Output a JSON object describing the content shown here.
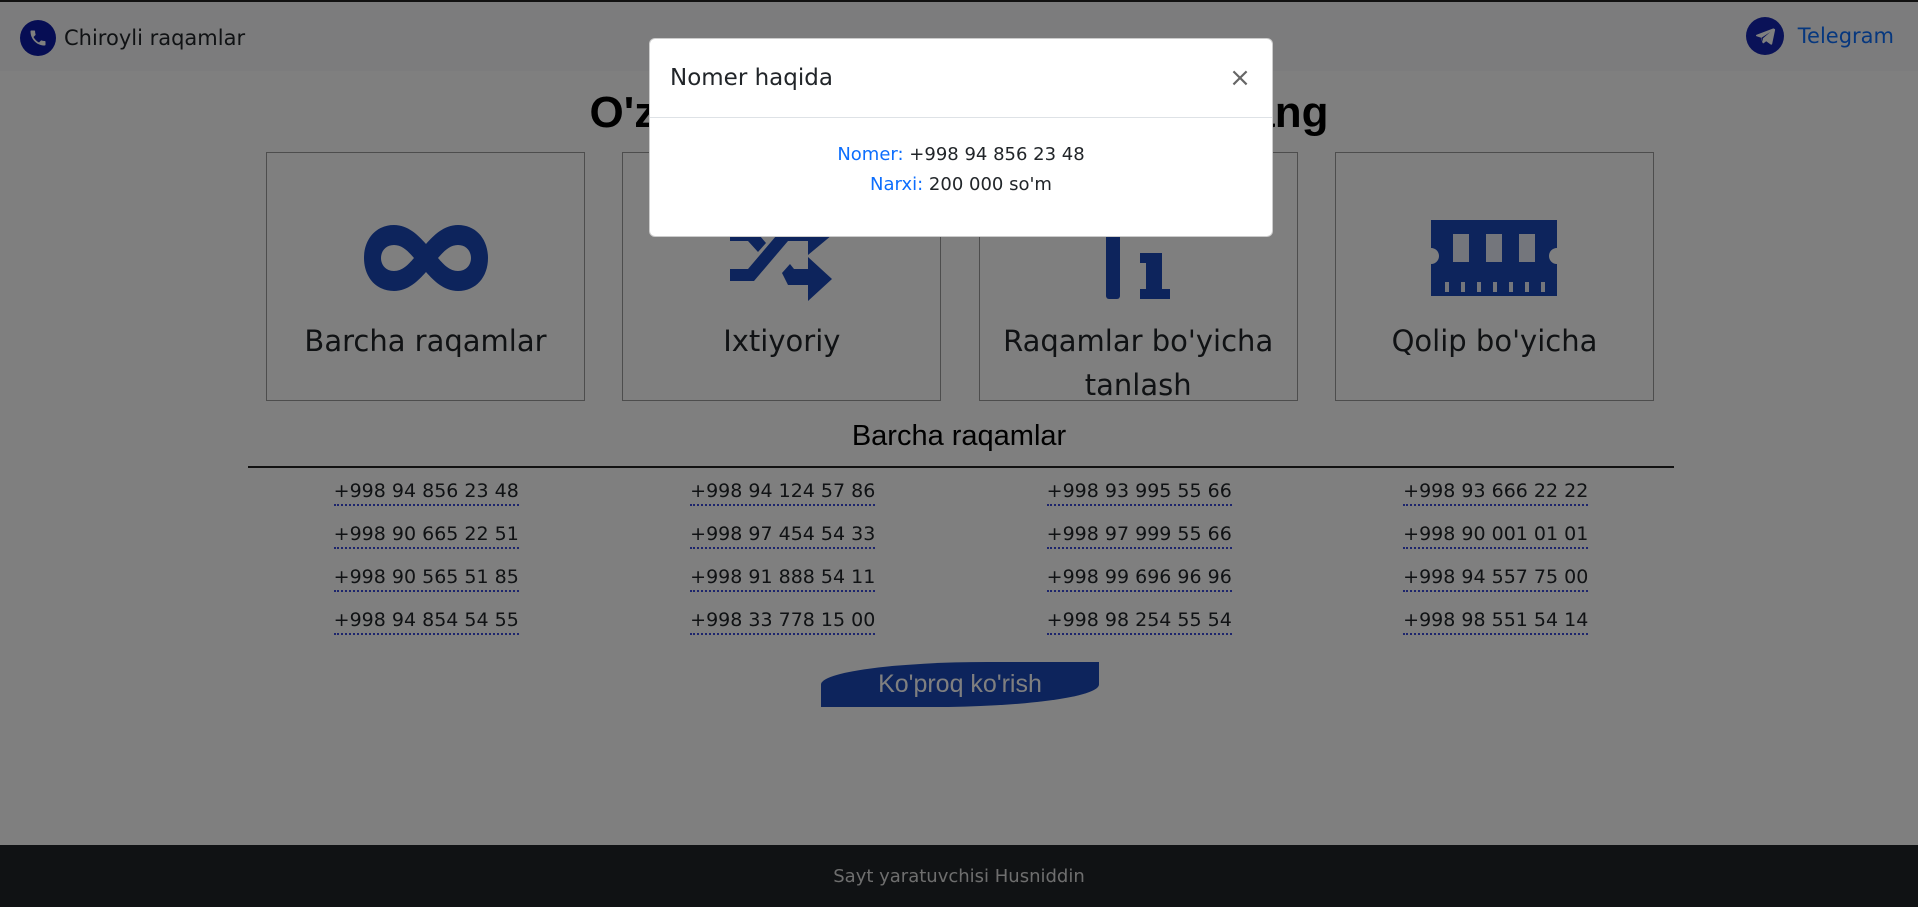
{
  "navbar": {
    "brand": "Chiroyli raqamlar",
    "telegram": "Telegram"
  },
  "hero": {
    "heading": "O'zingizga yoqqan raqamni tanlang"
  },
  "categories": [
    {
      "label": "Barcha raqamlar",
      "icon": "infinity-icon"
    },
    {
      "label": "Ixtiyoriy",
      "icon": "shuffle-icon"
    },
    {
      "label": "Raqamlar bo'yicha tanlash",
      "icon": "numbers-info-icon"
    },
    {
      "label": "Qolip bo'yicha",
      "icon": "memory-icon"
    }
  ],
  "list": {
    "title": "Barcha raqamlar",
    "numbers": [
      "+998 94 856 23 48",
      "+998 94 124 57 86",
      "+998 93 995 55 66",
      "+998 93 666 22 22",
      "+998 90 665 22 51",
      "+998 97 454 54 33",
      "+998 97 999 55 66",
      "+998 90 001 01 01",
      "+998 90 565 51 85",
      "+998 91 888 54 11",
      "+998 99 696 96 96",
      "+998 94 557 75 00",
      "+998 94 854 54 55",
      "+998 33 778 15 00",
      "+998 98 254 55 54",
      "+998 98 551 54 14"
    ],
    "more_button": "Ko'proq ko'rish"
  },
  "footer": {
    "text": "Sayt yaratuvchisi Husniddin"
  },
  "modal": {
    "title": "Nomer haqida",
    "close": "×",
    "number_label": "Nomer:",
    "number_value": "+998 94 856 23 48",
    "price_label": "Narxi:",
    "price_value": "200 000 so'm"
  },
  "colors": {
    "accent": "#1a49b8",
    "link": "#0d6efd",
    "footer_bg": "#212529"
  }
}
